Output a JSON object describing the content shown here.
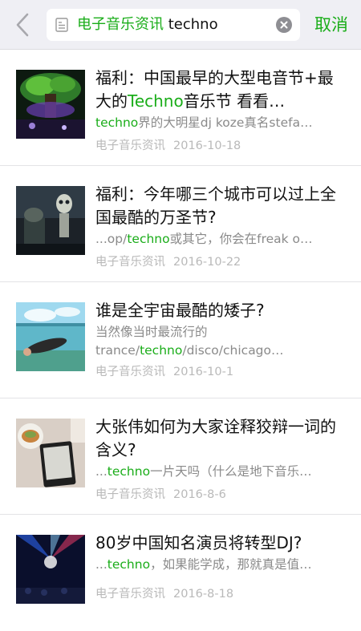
{
  "search": {
    "account_tag": "电子音乐资讯",
    "query": "techno",
    "cancel_label": "取消"
  },
  "colors": {
    "accent": "#1aad19",
    "gray_text": "#8a8a8a",
    "meta_text": "#b9b9b9"
  },
  "results": [
    {
      "title_pre": "福利：中国最早的大型电音节+最大的",
      "title_hl": "Techno",
      "title_post": "音乐节 看看…",
      "snippet_pre": "",
      "snippet_hl": "techno",
      "snippet_post": "界的大明星dj koze真名stefa…",
      "source": "电子音乐资讯",
      "date": "2016-10-18",
      "thumb_icon": "festival-stage-image"
    },
    {
      "title_pre": "福利：今年哪三个城市可以过上全国最酷的万圣节?",
      "title_hl": "",
      "title_post": "",
      "snippet_pre": "...op/",
      "snippet_hl": "techno",
      "snippet_post": "或其它，你会在freak o…",
      "source": "电子音乐资讯",
      "date": "2016-10-22",
      "thumb_icon": "halloween-skeleton-image"
    },
    {
      "title_pre": "谁是全宇宙最酷的矮子?",
      "title_hl": "",
      "title_post": "",
      "snippet_line1": "当然像当时最流行的",
      "snippet_pre": "trance/",
      "snippet_hl": "techno",
      "snippet_post": "/disco/chicago…",
      "source": "电子音乐资讯",
      "date": "2016-10-1",
      "thumb_icon": "underwater-swimmer-image"
    },
    {
      "title_pre": "大张伟如何为大家诠释狡辩一词的含义?",
      "title_hl": "",
      "title_post": "",
      "snippet_pre": "...",
      "snippet_hl": "techno",
      "snippet_post": "一片天吗（什么是地下音乐…",
      "source": "电子音乐资讯",
      "date": "2016-8-6",
      "thumb_icon": "ereader-desk-image"
    },
    {
      "title_pre": "80岁中国知名演员将转型DJ?",
      "title_hl": "",
      "title_post": "",
      "snippet_pre": "...",
      "snippet_hl": "techno",
      "snippet_post": "，如果能学成，那就真是值…",
      "source": "电子音乐资讯",
      "date": "2016-8-18",
      "thumb_icon": "concert-lights-image"
    }
  ]
}
